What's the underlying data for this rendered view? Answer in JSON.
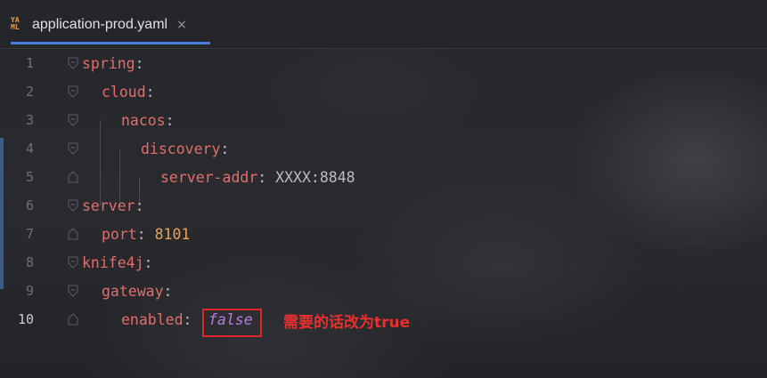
{
  "tab": {
    "icon": "yaml-file-icon",
    "icon_text_top": "YA",
    "icon_text_bottom": "ML",
    "filename": "application-prod.yaml",
    "close": "×"
  },
  "lines": [
    {
      "n": "1",
      "key": "spring",
      "colon": ":",
      "value": ""
    },
    {
      "n": "2",
      "key": "cloud",
      "colon": ":",
      "value": ""
    },
    {
      "n": "3",
      "key": "nacos",
      "colon": ":",
      "value": ""
    },
    {
      "n": "4",
      "key": "discovery",
      "colon": ":",
      "value": ""
    },
    {
      "n": "5",
      "key": "server-addr",
      "colon": ":",
      "value": " XXXX:8848"
    },
    {
      "n": "6",
      "key": "server",
      "colon": ":",
      "value": ""
    },
    {
      "n": "7",
      "key": "port",
      "colon": ":",
      "value": " 8101"
    },
    {
      "n": "8",
      "key": "knife4j",
      "colon": ":",
      "value": ""
    },
    {
      "n": "9",
      "key": "gateway",
      "colon": ":",
      "value": ""
    },
    {
      "n": "10",
      "key": "enabled",
      "colon": ":",
      "value": "false"
    }
  ],
  "annotation": "需要的话改为true",
  "colors": {
    "key": "#e46c6c",
    "number": "#e8a35a",
    "boolean": "#b67de0",
    "highlight_border": "#e0262a",
    "annotation": "#e8302f",
    "tab_underline": "#4a7cdb"
  }
}
